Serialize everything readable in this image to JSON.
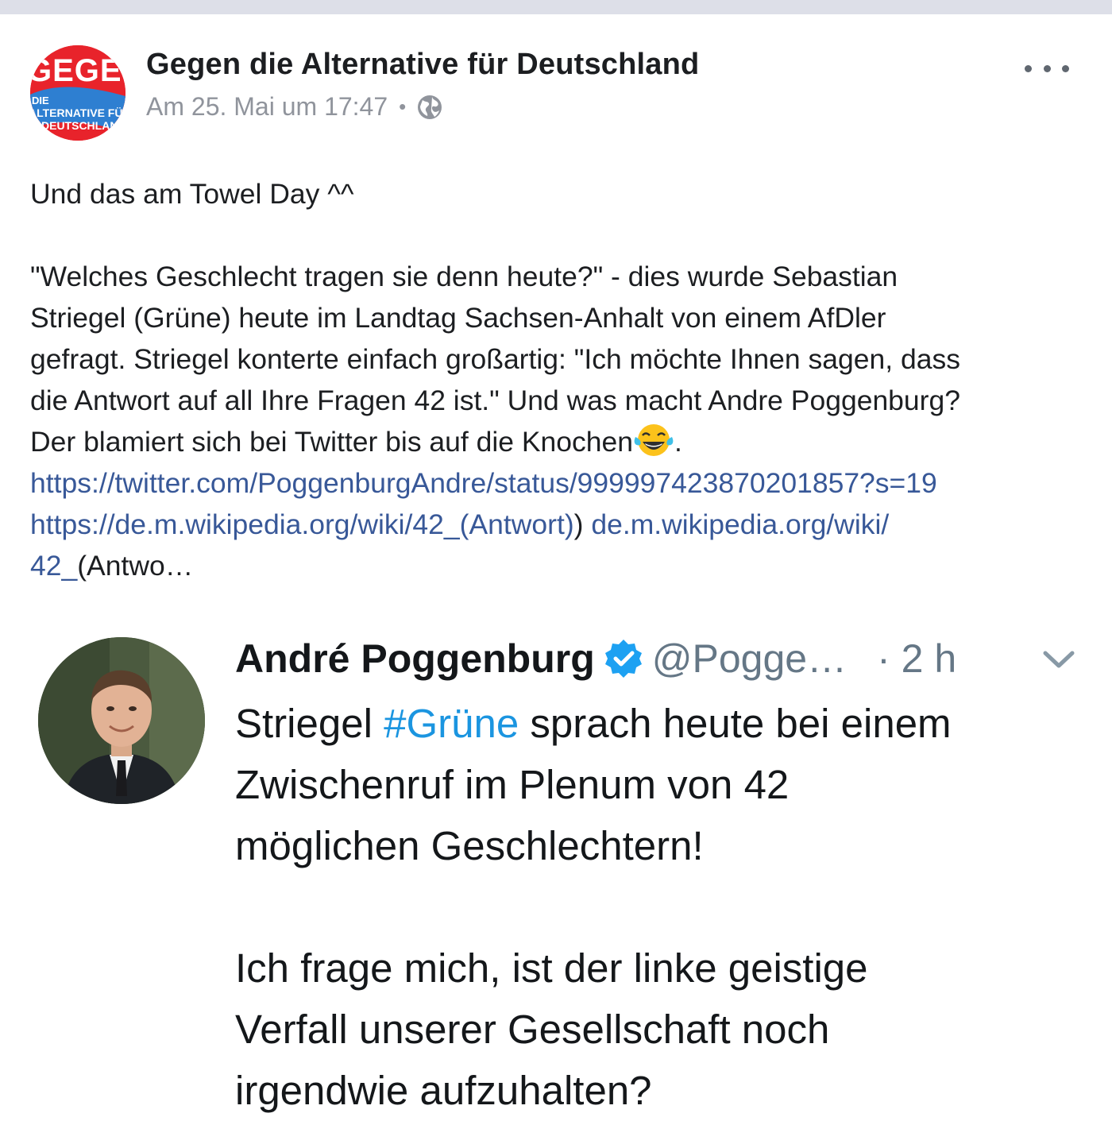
{
  "post": {
    "page_name": "Gegen die Alternative für Deutschland",
    "timestamp": "Am 25. Mai um 17:47",
    "separator": "•",
    "privacy_icon": "globe-icon",
    "avatar_logo": {
      "line1": "GEGEN",
      "line2": "DIE",
      "line3": "ALTERNATIVE FÜR",
      "line4": "DEUTSCHLAND"
    },
    "lines": [
      "Und das am Towel Day  ^^",
      "\"Welches Geschlecht tragen sie denn heute?\" - dies wurde Sebastian",
      "Striegel (Grüne) heute im Landtag Sachsen-Anhalt von einem AfDler",
      "gefragt. Striegel konterte einfach großartig: \"Ich möchte Ihnen sagen, dass",
      "die Antwort auf all Ihre Fragen 42 ist.\" Und was macht Andre Poggenburg?",
      "Der blamiert sich bei Twitter bis auf die Knochen"
    ],
    "emoji": "face-with-tears-of-joy-icon",
    "after_emoji": ".",
    "link1": "https://twitter.com/PoggenburgAndre/status/999997423870201857?s=19",
    "link2": "https://de.m.wikipedia.org/wiki/42_(Antwort)",
    "link2_paren": ")",
    "link3_part1": "de.m.wikipedia.org/wiki/",
    "link3_part2": "42_",
    "link3_rest": "(Antwo…"
  },
  "tweet": {
    "author": "André Poggenburg",
    "handle": "@Pogge…",
    "time": "· 2 h",
    "verified_icon": "verified-badge-icon",
    "text_line1_pre": "Striegel ",
    "hashtag": "#Grüne",
    "text_line1_post": " sprach heute bei einem",
    "text_line2": "Zwischenruf im Plenum von 42",
    "text_line3": "möglichen Geschlechtern!",
    "text_line4": "Ich frage mich, ist der linke geistige",
    "text_line5": "Verfall unserer Gesellschaft noch",
    "text_line6": "irgendwie aufzuhalten?"
  },
  "colors": {
    "link": "#385898",
    "hashtag": "#1b95e0",
    "verified": "#1da1f2",
    "logo_red": "#e8232b"
  }
}
